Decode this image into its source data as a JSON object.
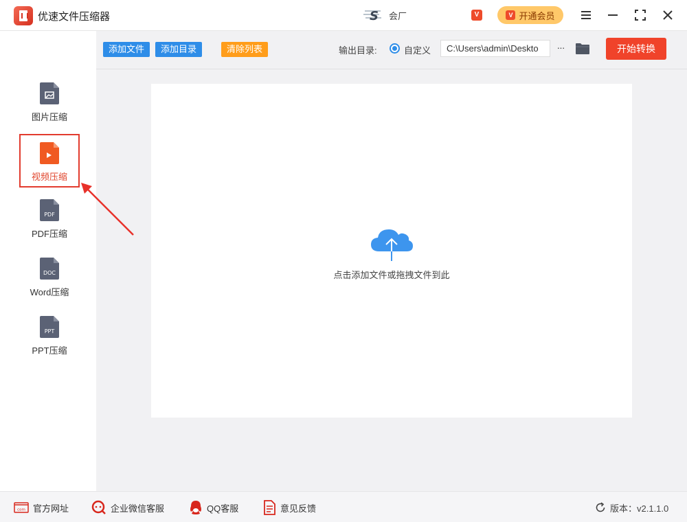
{
  "app": {
    "title": "优速文件压缩器"
  },
  "header": {
    "username": "会厂",
    "vip_badge": "V",
    "vip_button_label": "开通会员"
  },
  "sidebar": {
    "items": [
      {
        "label": "图片压缩",
        "icon": "image-file-icon",
        "active": false
      },
      {
        "label": "视频压缩",
        "icon": "video-file-icon",
        "active": true
      },
      {
        "label": "PDF压缩",
        "icon": "pdf-file-icon",
        "tag": "PDF",
        "active": false
      },
      {
        "label": "Word压缩",
        "icon": "doc-file-icon",
        "tag": "DOC",
        "active": false
      },
      {
        "label": "PPT压缩",
        "icon": "ppt-file-icon",
        "tag": "PPT",
        "active": false
      }
    ]
  },
  "toolbar": {
    "add_file_label": "添加文件",
    "add_dir_label": "添加目录",
    "clear_list_label": "清除列表",
    "output_dir_label": "输出目录:",
    "custom_option_label": "自定义",
    "output_path": "C:\\Users\\admin\\Deskto",
    "more_label": "···",
    "start_button_label": "开始转换"
  },
  "dropzone": {
    "hint": "点击添加文件或拖拽文件到此"
  },
  "footer": {
    "site_label": "官方网址",
    "site_icon_text": "com",
    "wechat_label": "企业微信客服",
    "qq_label": "QQ客服",
    "feedback_label": "意见反馈",
    "version_label": "版本：v2.1.1.0"
  },
  "colors": {
    "accent_blue": "#2e8de8",
    "accent_orange": "#ff9d1b",
    "start_red": "#f0432a",
    "active_red": "#e23b2e",
    "file_icon_gray": "#5b6275",
    "video_icon_orange": "#f05a22",
    "vip_gold": "#ffc869",
    "footer_red": "#d8261c"
  }
}
